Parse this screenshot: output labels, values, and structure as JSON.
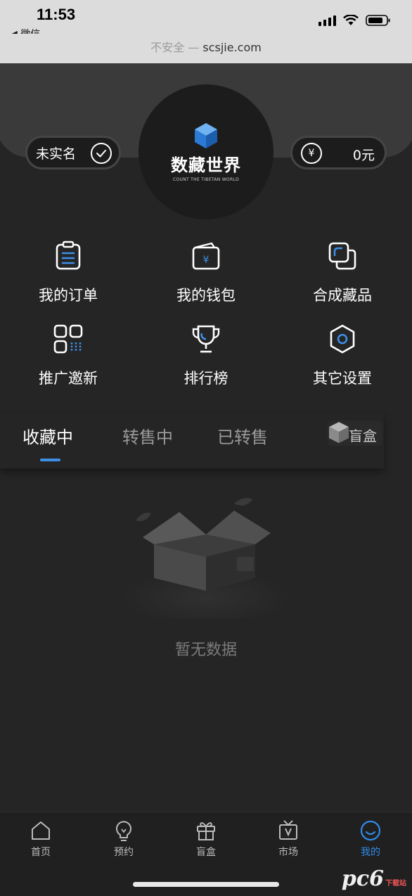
{
  "status_bar": {
    "time": "11:53",
    "back_app": "◀ 微信"
  },
  "browser": {
    "insecure_label": "不安全 —",
    "domain": "scsjie.com"
  },
  "header": {
    "verify_label": "未实名",
    "currency_symbol": "¥",
    "balance": "0元",
    "logo_title": "数藏世界",
    "logo_subtitle": "COUNT THE TIBETAN WORLD"
  },
  "menu": [
    {
      "label": "我的订单",
      "icon": "order-icon"
    },
    {
      "label": "我的钱包",
      "icon": "wallet-icon"
    },
    {
      "label": "合成藏品",
      "icon": "synthesize-icon"
    },
    {
      "label": "推广邀新",
      "icon": "invite-icon"
    },
    {
      "label": "排行榜",
      "icon": "trophy-icon"
    },
    {
      "label": "其它设置",
      "icon": "settings-icon"
    }
  ],
  "tabs": [
    {
      "label": "收藏中",
      "active": true
    },
    {
      "label": "转售中",
      "active": false
    },
    {
      "label": "已转售",
      "active": false
    }
  ],
  "blind_box_tab": "盲盒",
  "empty_state": "暂无数据",
  "bottom_nav": [
    {
      "label": "首页",
      "icon": "home-icon",
      "active": false
    },
    {
      "label": "预约",
      "icon": "lightbulb-icon",
      "active": false
    },
    {
      "label": "盲盒",
      "icon": "gift-icon",
      "active": false
    },
    {
      "label": "市场",
      "icon": "market-icon",
      "active": false
    },
    {
      "label": "我的",
      "icon": "profile-icon",
      "active": true
    }
  ],
  "watermark": {
    "brand": "pc6",
    "sub": "下载站"
  },
  "colors": {
    "accent": "#3d8fe6",
    "background": "#252526"
  }
}
